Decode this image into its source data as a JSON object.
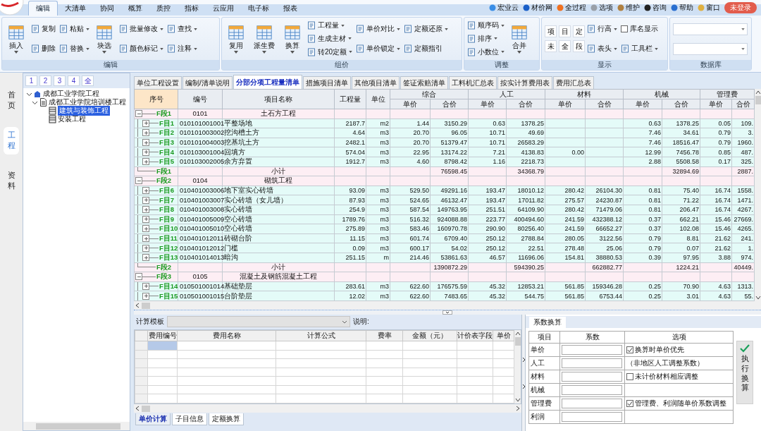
{
  "app_tabs": [
    {
      "label": "编辑",
      "selected": true
    },
    {
      "label": "大清单",
      "selected": false
    },
    {
      "label": "协同",
      "selected": false
    },
    {
      "label": "概算",
      "selected": false
    },
    {
      "label": "质控",
      "selected": false
    },
    {
      "label": "指标",
      "selected": false
    },
    {
      "label": "云应用",
      "selected": false
    },
    {
      "label": "电子标",
      "selected": false
    },
    {
      "label": "报表",
      "selected": false
    }
  ],
  "top_links": [
    "宏业云",
    "材价网",
    "全过程",
    "选项",
    "维护",
    "咨询",
    "帮助",
    "窗口"
  ],
  "login_badge": "未登录",
  "ribbon": [
    {
      "title": "编辑",
      "columns": [
        [
          {
            "kind": "large",
            "label": "插入",
            "dropdown": true
          }
        ],
        [
          {
            "kind": "small",
            "label": "复制",
            "dropdown": false
          },
          {
            "kind": "small",
            "label": "删除",
            "dropdown": false
          }
        ],
        [
          {
            "kind": "small",
            "label": "粘贴",
            "dropdown": true
          },
          {
            "kind": "small",
            "label": "替换",
            "dropdown": true
          }
        ],
        [
          {
            "kind": "large",
            "label": "块选",
            "dropdown": true
          }
        ],
        [
          {
            "kind": "small",
            "label": "批量修改",
            "dropdown": true
          },
          {
            "kind": "small",
            "label": "颜色标记",
            "dropdown": true
          }
        ],
        [
          {
            "kind": "small",
            "label": "查找",
            "dropdown": true
          },
          {
            "kind": "small",
            "label": "注释",
            "dropdown": true
          }
        ]
      ]
    },
    {
      "title": "组价",
      "columns": [
        [
          {
            "kind": "large",
            "label": "复用",
            "dropdown": true
          }
        ],
        [
          {
            "kind": "large",
            "label": "派生费",
            "dropdown": true
          }
        ],
        [
          {
            "kind": "large",
            "label": "换算",
            "dropdown": true
          }
        ],
        [
          {
            "kind": "small",
            "label": "工程量",
            "dropdown": true
          },
          {
            "kind": "small",
            "label": "生成主材",
            "dropdown": true
          },
          {
            "kind": "small",
            "label": "转20定额",
            "dropdown": true
          }
        ],
        [
          {
            "kind": "small",
            "label": "单价对比",
            "dropdown": true
          },
          {
            "kind": "small",
            "label": "单价锁定",
            "dropdown": true
          }
        ],
        [
          {
            "kind": "small",
            "label": "定额还原",
            "dropdown": true
          },
          {
            "kind": "small",
            "label": "定额指引",
            "dropdown": false
          }
        ]
      ]
    },
    {
      "title": "调整",
      "columns": [
        [
          {
            "kind": "small",
            "label": "顺序码",
            "dropdown": true
          },
          {
            "kind": "small",
            "label": "排序",
            "dropdown": true
          },
          {
            "kind": "small",
            "label": "小数位",
            "dropdown": true
          }
        ],
        [
          {
            "kind": "large",
            "label": "合并",
            "dropdown": true
          }
        ]
      ]
    },
    {
      "title": "显示",
      "columns": [
        [
          {
            "kind": "letter",
            "label": "项"
          },
          {
            "kind": "letter",
            "label": "未"
          }
        ],
        [
          {
            "kind": "letter",
            "label": "目"
          },
          {
            "kind": "letter",
            "label": "全"
          }
        ],
        [
          {
            "kind": "letter",
            "label": "定"
          },
          {
            "kind": "letter",
            "label": "段"
          }
        ],
        [
          {
            "kind": "small",
            "label": "行高",
            "dropdown": true
          },
          {
            "kind": "small",
            "label": "表头",
            "dropdown": true
          }
        ],
        [
          {
            "kind": "checkbox",
            "label": "库名显示",
            "checked": false
          },
          {
            "kind": "small",
            "label": "工具栏",
            "dropdown": true
          }
        ]
      ]
    },
    {
      "title": "数据库",
      "columns": [
        [
          {
            "kind": "combo"
          },
          {
            "kind": "combo"
          }
        ]
      ]
    }
  ],
  "side_nav": [
    {
      "label": "首页",
      "selected": false
    },
    {
      "label": "工程",
      "selected": true
    },
    {
      "label": "资料",
      "selected": false
    }
  ],
  "tree": {
    "level_buttons": [
      "1",
      "2",
      "3",
      "4",
      "全"
    ],
    "nodes": [
      {
        "label": "成都工业学院工程",
        "expanded": true,
        "selected": false,
        "children": [
          {
            "label": "成都工业学院培训楼工程",
            "expanded": true,
            "selected": false,
            "children": [
              {
                "label": "建筑与装饰工程",
                "selected": true
              },
              {
                "label": "安装工程",
                "selected": false
              }
            ]
          }
        ]
      }
    ]
  },
  "sheet_tabs": [
    {
      "label": "单位工程设置",
      "selected": false
    },
    {
      "label": "编制/清单说明",
      "selected": false
    },
    {
      "label": "分部分项工程量清单",
      "selected": true
    },
    {
      "label": "措施项目清单",
      "selected": false
    },
    {
      "label": "其他项目清单",
      "selected": false
    },
    {
      "label": "签证索赔清单",
      "selected": false
    },
    {
      "label": "工料机汇总表",
      "selected": false
    },
    {
      "label": "按实计算费用表",
      "selected": false
    },
    {
      "label": "费用汇总表",
      "selected": false
    }
  ],
  "table": {
    "columns": [
      {
        "label": "序号",
        "selected": true
      },
      {
        "label": "编号",
        "selected": false
      },
      {
        "label": "项目名称",
        "selected": false
      },
      {
        "label": "工程量",
        "selected": false
      },
      {
        "label": "单位",
        "selected": false
      }
    ],
    "groups": [
      {
        "label": "综合",
        "sub": [
          "单价",
          "合价"
        ]
      },
      {
        "label": "人工",
        "sub": [
          "单价",
          "合价"
        ]
      },
      {
        "label": "材料",
        "sub": [
          "单价",
          "合价"
        ]
      },
      {
        "label": "机械",
        "sub": [
          "单价",
          "合价"
        ]
      },
      {
        "label": "管理费",
        "sub": [
          "单价",
          "合价"
        ]
      }
    ],
    "rows": [
      {
        "kind": "section",
        "no": "F段1",
        "code": "0101",
        "name": "土石方工程",
        "expanded": true
      },
      {
        "kind": "item",
        "no": "F目1",
        "code": "010101001001",
        "name": "平整场地",
        "qty": "2187.7",
        "unit": "m2",
        "values": {
          "zu": "1.44",
          "zt": "3150.29",
          "ru": "0.63",
          "rt": "1378.25",
          "ju": "0.63",
          "jt": "1378.25",
          "gu": "0.05",
          "gt": "109."
        },
        "expanded": false
      },
      {
        "kind": "item",
        "no": "F目2",
        "code": "010101003002",
        "name": "挖沟槽土方",
        "qty": "4.64",
        "unit": "m3",
        "values": {
          "zu": "20.70",
          "zt": "96.05",
          "ru": "10.71",
          "rt": "49.69",
          "ju": "7.46",
          "jt": "34.61",
          "gu": "0.79",
          "gt": "3."
        },
        "expanded": false
      },
      {
        "kind": "item",
        "no": "F目3",
        "code": "010101004003",
        "name": "挖基坑土方",
        "qty": "2482.1",
        "unit": "m3",
        "values": {
          "zu": "20.70",
          "zt": "51379.47",
          "ru": "10.71",
          "rt": "26583.29",
          "ju": "7.46",
          "jt": "18516.47",
          "gu": "0.79",
          "gt": "1960."
        },
        "expanded": false
      },
      {
        "kind": "item",
        "no": "F目4",
        "code": "010103001004",
        "name": "回填方",
        "qty": "574.04",
        "unit": "m3",
        "values": {
          "zu": "22.95",
          "zt": "13174.22",
          "ru": "7.21",
          "rt": "4138.83",
          "cu": "0.00",
          "ju": "12.99",
          "jt": "7456.78",
          "gu": "0.85",
          "gt": "487."
        },
        "expanded": false
      },
      {
        "kind": "item",
        "no": "F目5",
        "code": "010103002005",
        "name": "余方弃置",
        "qty": "1912.7",
        "unit": "m3",
        "values": {
          "zu": "4.60",
          "zt": "8798.42",
          "ru": "1.16",
          "rt": "2218.73",
          "ju": "2.88",
          "jt": "5508.58",
          "gu": "0.17",
          "gt": "325."
        },
        "expanded": false
      },
      {
        "kind": "subtotal",
        "no": "F段1",
        "name": "小计",
        "values": {
          "zt": "76598.45",
          "rt": "34368.79",
          "jt": "32894.69",
          "gt": "2887."
        }
      },
      {
        "kind": "section",
        "no": "F段2",
        "code": "0104",
        "name": "砌筑工程",
        "expanded": true
      },
      {
        "kind": "item",
        "no": "F目6",
        "code": "010401003006",
        "name": "地下室实心砖墙",
        "qty": "93.09",
        "unit": "m3",
        "values": {
          "zu": "529.50",
          "zt": "49291.16",
          "ru": "193.47",
          "rt": "18010.12",
          "cu": "280.42",
          "ct": "26104.30",
          "ju": "0.81",
          "jt": "75.40",
          "gu": "16.74",
          "gt": "1558."
        },
        "expanded": false
      },
      {
        "kind": "item",
        "no": "F目7",
        "code": "010401003007",
        "name": "实心砖墙（女儿墙）",
        "qty": "87.93",
        "unit": "m3",
        "values": {
          "zu": "524.65",
          "zt": "46132.47",
          "ru": "193.47",
          "rt": "17011.82",
          "cu": "275.57",
          "ct": "24230.87",
          "ju": "0.81",
          "jt": "71.22",
          "gu": "16.74",
          "gt": "1471."
        },
        "expanded": false
      },
      {
        "kind": "item",
        "no": "F目8",
        "code": "010401003008",
        "name": "实心砖墙",
        "qty": "254.9",
        "unit": "m3",
        "values": {
          "zu": "587.54",
          "zt": "149763.95",
          "ru": "251.51",
          "rt": "64109.90",
          "cu": "280.42",
          "ct": "71479.06",
          "ju": "0.81",
          "jt": "206.47",
          "gu": "16.74",
          "gt": "4267."
        },
        "expanded": false
      },
      {
        "kind": "item",
        "no": "F目9",
        "code": "010401005009",
        "name": "空心砖墙",
        "qty": "1789.76",
        "unit": "m3",
        "values": {
          "zu": "516.32",
          "zt": "924088.88",
          "ru": "223.77",
          "rt": "400494.60",
          "cu": "241.59",
          "ct": "432388.12",
          "ju": "0.37",
          "jt": "662.21",
          "gu": "15.46",
          "gt": "27669."
        },
        "expanded": false
      },
      {
        "kind": "item",
        "no": "F目10",
        "code": "010401005010",
        "name": "空心砖墙",
        "qty": "275.89",
        "unit": "m3",
        "values": {
          "zu": "583.46",
          "zt": "160970.78",
          "ru": "290.90",
          "rt": "80256.40",
          "cu": "241.59",
          "ct": "66652.27",
          "ju": "0.37",
          "jt": "102.08",
          "gu": "15.46",
          "gt": "4265."
        },
        "expanded": false
      },
      {
        "kind": "item",
        "no": "F目11",
        "code": "010401012011",
        "name": "砖砌台阶",
        "qty": "11.15",
        "unit": "m3",
        "values": {
          "zu": "601.74",
          "zt": "6709.40",
          "ru": "250.12",
          "rt": "2788.84",
          "cu": "280.05",
          "ct": "3122.56",
          "ju": "0.79",
          "jt": "8.81",
          "gu": "21.62",
          "gt": "241."
        },
        "expanded": false
      },
      {
        "kind": "item",
        "no": "F目12",
        "code": "010401012012",
        "name": "门槛",
        "qty": "0.09",
        "unit": "m3",
        "values": {
          "zu": "600.17",
          "zt": "54.02",
          "ru": "250.12",
          "rt": "22.51",
          "cu": "278.48",
          "ct": "25.06",
          "ju": "0.79",
          "jt": "0.07",
          "gu": "21.62",
          "gt": "1."
        },
        "expanded": false
      },
      {
        "kind": "item",
        "no": "F目13",
        "code": "010401014013",
        "name": "暗沟",
        "qty": "251.15",
        "unit": "m",
        "values": {
          "zu": "214.46",
          "zt": "53861.63",
          "ru": "46.57",
          "rt": "11696.06",
          "cu": "154.81",
          "ct": "38880.53",
          "ju": "0.39",
          "jt": "97.95",
          "gu": "3.88",
          "gt": "974."
        },
        "expanded": false
      },
      {
        "kind": "subtotal",
        "no": "F段2",
        "name": "小计",
        "values": {
          "zt": "1390872.29",
          "rt": "594390.25",
          "ct": "662882.77",
          "jt": "1224.21",
          "gt": "40449."
        }
      },
      {
        "kind": "section",
        "no": "F段3",
        "code": "0105",
        "name": "混凝土及钢筋混凝土工程",
        "expanded": true
      },
      {
        "kind": "item",
        "no": "F目14",
        "code": "010501001014",
        "name": "基础垫层",
        "qty": "283.61",
        "unit": "m3",
        "values": {
          "zu": "622.60",
          "zt": "176575.59",
          "ru": "45.32",
          "rt": "12853.21",
          "cu": "561.85",
          "ct": "159346.28",
          "ju": "0.25",
          "jt": "70.90",
          "gu": "4.63",
          "gt": "1313."
        },
        "expanded": false
      },
      {
        "kind": "item",
        "no": "F目15",
        "code": "010501001015",
        "name": "台阶垫层",
        "qty": "12.02",
        "unit": "m3",
        "values": {
          "zu": "622.60",
          "zt": "7483.65",
          "ru": "45.32",
          "rt": "544.75",
          "cu": "561.85",
          "ct": "6753.44",
          "ju": "0.25",
          "jt": "3.01",
          "gu": "4.63",
          "gt": "55."
        },
        "expanded": false
      }
    ]
  },
  "calc_panel": {
    "template_label": "计算模板",
    "note_label": "说明:",
    "columns": [
      "费用编号",
      "费用名称",
      "计算公式",
      "费率",
      "金额（元）",
      "计价表字段",
      "单价"
    ],
    "rows": [
      {
        "selected": true
      },
      {
        "selected": false
      },
      {
        "selected": false
      },
      {
        "selected": false
      },
      {
        "selected": false
      },
      {
        "selected": false
      },
      {
        "selected": false
      }
    ]
  },
  "bottom_tabs": [
    {
      "label": "单价计算",
      "selected": true
    },
    {
      "label": "子目信息",
      "selected": false
    },
    {
      "label": "定额换算",
      "selected": false
    }
  ],
  "coef_panel": {
    "tab": "系数换算",
    "headers": [
      "项目",
      "系数",
      "选项"
    ],
    "rows": [
      {
        "item": "单价",
        "option": {
          "kind": "checkbox",
          "label": "换算时单价优先",
          "checked": true
        }
      },
      {
        "item": "人工",
        "option": {
          "kind": "note",
          "label": "（非地区人工调整系数）"
        }
      },
      {
        "item": "材料",
        "option": {
          "kind": "checkbox",
          "label": "未计价材料相应调整",
          "checked": false
        }
      },
      {
        "item": "机械"
      },
      {
        "item": "管理费",
        "option": {
          "kind": "checkbox",
          "label": "管理费、利润随单价系数调整",
          "checked": true
        }
      },
      {
        "item": "利润"
      }
    ],
    "execute_button": "执行换算"
  }
}
